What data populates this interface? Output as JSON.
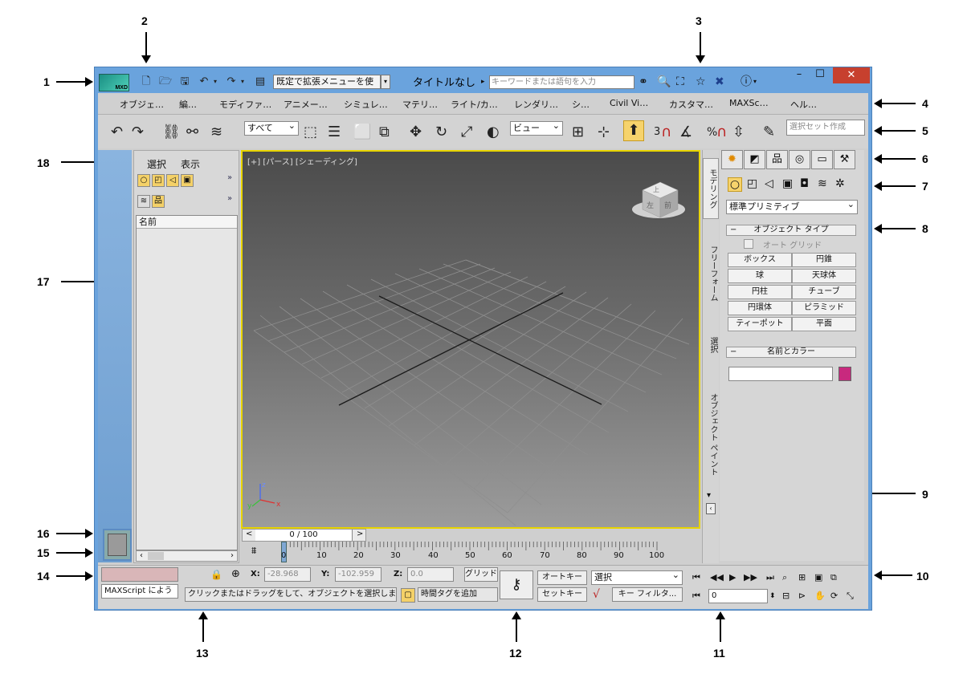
{
  "callouts": [
    "1",
    "2",
    "3",
    "4",
    "5",
    "6",
    "7",
    "8",
    "9",
    "10",
    "11",
    "12",
    "13",
    "14",
    "15",
    "16",
    "17",
    "18"
  ],
  "app": {
    "logo_text": "MXD",
    "title": "タイトルなし",
    "workspace": "既定で拡張メニューを使",
    "search_placeholder": "キーワードまたは語句を入力"
  },
  "menu": [
    "オブジェ…",
    "編…",
    "モディファ…",
    "アニメー…",
    "シミュレ…",
    "マテリ…",
    "ライト/カ…",
    "レンダリ…",
    "シ…",
    "Civil Vi…",
    "カスタマ…",
    "MAXSc…",
    "ヘル…"
  ],
  "toolbar": {
    "selection_filter": "すべて",
    "ref_coord": "ビュー",
    "snap_label": "3",
    "percent": "%",
    "named_selection_placeholder": "選択セット作成"
  },
  "scene_explorer": {
    "menu_select": "選択",
    "menu_display": "表示",
    "column_name": "名前"
  },
  "viewport": {
    "label": "[+] [パース] [シェーディング]",
    "viewcube_top": "上",
    "viewcube_front": "前",
    "viewcube_left": "左",
    "axis_z": "z",
    "axis_y": "y",
    "axis_x": "x"
  },
  "ribbon_tabs": [
    "モデリング",
    "フリーフォーム",
    "選択",
    "オブジェクト ペイント"
  ],
  "command_panel": {
    "category": "標準プリミティブ",
    "rollout_object_type": "オブジェクト タイプ",
    "auto_grid": "オート グリッド",
    "primitives": [
      "ボックス",
      "円錐",
      "球",
      "天球体",
      "円柱",
      "チューブ",
      "円環体",
      "ピラミッド",
      "ティーポット",
      "平面"
    ],
    "rollout_name_color": "名前とカラー",
    "minus": "−",
    "color": "#c8297e"
  },
  "timeslider": {
    "position": "0 / 100",
    "ticks": [
      "0",
      "10",
      "20",
      "30",
      "40",
      "50",
      "60",
      "70",
      "80",
      "90",
      "100"
    ]
  },
  "status": {
    "maxscript": "MAXScript によう",
    "x_label": "X:",
    "x_value": "-28.968",
    "y_label": "Y:",
    "y_value": "-102.959",
    "z_label": "Z:",
    "z_value": "0.0",
    "grid": "グリッド",
    "prompt": "クリックまたはドラッグをして、オブジェクトを選択します",
    "add_time_tag": "時間タグを追加",
    "auto_key": "オートキー",
    "set_key": "セットキー",
    "key_mode": "選択",
    "key_filters": "キー フィルタ...",
    "frame": "0"
  }
}
